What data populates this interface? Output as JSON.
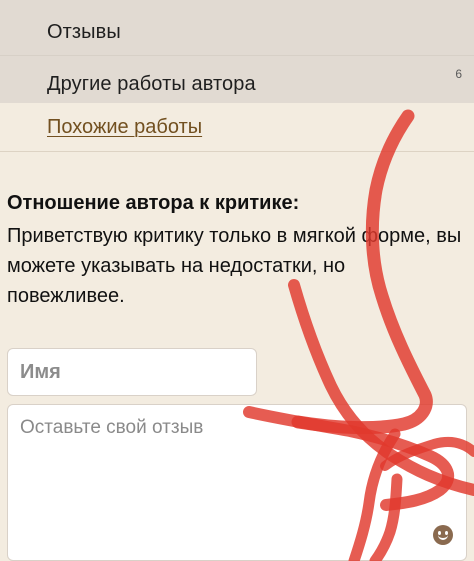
{
  "nav": {
    "reviews_label": "Отзывы",
    "other_works_label": "Другие работы автора",
    "other_works_count": "6",
    "similar_works_label": "Похожие работы"
  },
  "critique": {
    "title": "Отношение автора к критике:",
    "text": "Приветствую критику только в мягкой форме, вы можете указывать на недостатки, но повежливее."
  },
  "form": {
    "name_placeholder": "Имя",
    "review_placeholder": "Оставьте свой отзыв"
  },
  "icons": {
    "emoji": "smiley-face-icon"
  },
  "colors": {
    "background": "#f3ece0",
    "nav_background": "#e1dad2",
    "link": "#725020",
    "emoji": "#8a6a4f",
    "scribble": "#e1382c"
  }
}
